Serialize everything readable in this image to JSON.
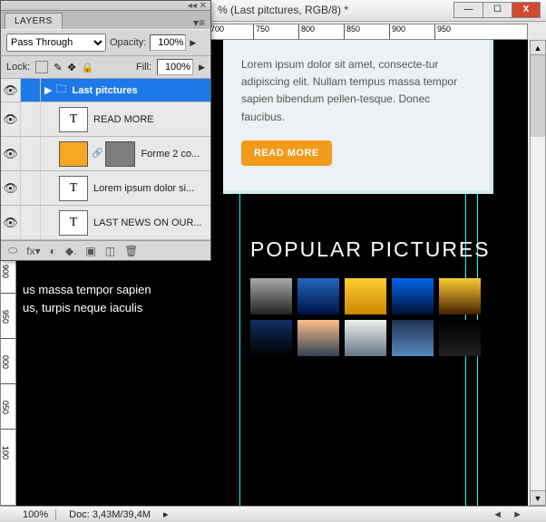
{
  "window": {
    "title": "% (Last pitctures, RGB/8) *",
    "buttons": {
      "min": "—",
      "max": "☐",
      "close": "X"
    }
  },
  "ruler_h": [
    "700",
    "750",
    "800",
    "850",
    "900",
    "950"
  ],
  "ruler_v": [
    "900",
    "950",
    "000",
    "050",
    "100"
  ],
  "canvas": {
    "card_text": "Lorem ipsum dolor sit amet, consecte-tur adipiscing elit. Nullam tempus massa tempor sapien bibendum pellen-tesque. Donec faucibus.",
    "card_button": "READ MORE",
    "overflow1": "us massa tempor sapien",
    "overflow2": "us, turpis neque iaculis",
    "heading": "POPULAR PICTURES"
  },
  "statusbar": {
    "zoom": "100%",
    "doc": "Doc: 3,43M/39,4M",
    "nav": "◄ ►"
  },
  "panel": {
    "grip": "◂◂ ✕",
    "tab": "LAYERS",
    "menu": "▾≡",
    "blend": "Pass Through",
    "blend_options": [
      "Pass Through"
    ],
    "opacity_label": "Opacity:",
    "opacity_value": "100%",
    "lock_label": "Lock:",
    "fill_label": "Fill:",
    "fill_value": "100%",
    "layers": [
      {
        "name": "Last pitctures",
        "type": "group"
      },
      {
        "name": "READ MORE",
        "type": "T"
      },
      {
        "name": "Forme 2 co...",
        "type": "swatch"
      },
      {
        "name": "Lorem ipsum dolor si...",
        "type": "T"
      },
      {
        "name": "LAST NEWS ON OUR...",
        "type": "T"
      }
    ],
    "footer": [
      "⬭",
      "fx▾",
      "◐",
      "◆.",
      "▣",
      "◫",
      "🗑"
    ]
  }
}
